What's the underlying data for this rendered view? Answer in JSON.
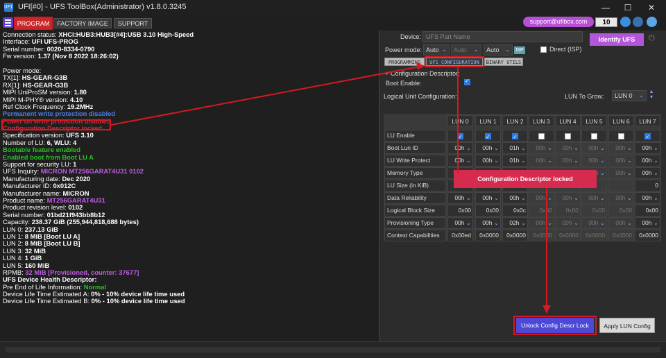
{
  "window": {
    "title": "UFI[#0] - UFS ToolBox(Administrator) v1.8.0.3245",
    "app_icon": "UFI",
    "minimize": "—",
    "maximize": "☐",
    "close": "✕"
  },
  "menu": {
    "tabs": [
      "PROGRAM",
      "FACTORY IMAGE",
      "SUPPORT"
    ],
    "support_email": "support@ufibox.com",
    "counter": "10"
  },
  "log": [
    {
      "text": "Connection status: ",
      "value": "XHCI:HUB3:HUB3[#4]:USB 3.10 High-Speed",
      "cls": ""
    },
    {
      "text": "Interface: ",
      "value": "UFI UFS-PROG",
      "cls": ""
    },
    {
      "text": " Serial number: ",
      "value": "0020-8334-0790",
      "cls": ""
    },
    {
      "text": " Fw version: ",
      "value": "1.37 (Nov  8 2022 18:26:02)",
      "cls": ""
    },
    {
      "text": "",
      "value": "",
      "cls": ""
    },
    {
      "text": "Power mode:",
      "value": "",
      "cls": ""
    },
    {
      "text": " TX[1]: ",
      "value": "HS-GEAR-G3B",
      "cls": ""
    },
    {
      "text": " RX[1]: ",
      "value": "HS-GEAR-G3B",
      "cls": ""
    },
    {
      "text": "MIPI UniProSM version: ",
      "value": "1.80",
      "cls": ""
    },
    {
      "text": "MIPI M-PHY® version: ",
      "value": "4.10",
      "cls": ""
    },
    {
      "text": "Ref Clock Frequency: ",
      "value": "19.2MHz",
      "cls": ""
    },
    {
      "text": "Permanent write protection disabled",
      "value": "",
      "cls": "c-blue"
    },
    {
      "text": "Power on write protection disabled",
      "value": "",
      "cls": "c-strike"
    },
    {
      "text": "Configuration Descriptor locked",
      "value": "",
      "cls": "c-red"
    },
    {
      "text": " Specification version: ",
      "value": "UFS 3.10",
      "cls": ""
    },
    {
      "text": " Number of LU: ",
      "value": "6, WLU: 4",
      "cls": ""
    },
    {
      "text": " Bootable feature enabled",
      "value": "",
      "cls": "c-green"
    },
    {
      "text": " Enabled boot from Boot LU A",
      "value": "",
      "cls": "c-green"
    },
    {
      "text": " Support for security LU: ",
      "value": "1",
      "cls": ""
    },
    {
      "text": " UFS Inquiry: ",
      "value": "MICRON   MT256GARAT4U31   0102",
      "cls": "purple-val"
    },
    {
      "text": " Manufacturing date: ",
      "value": "Dec 2020",
      "cls": ""
    },
    {
      "text": " Manufacturer ID: ",
      "value": "0x012C",
      "cls": ""
    },
    {
      "text": " Manufacturer name: ",
      "value": "MICRON",
      "cls": ""
    },
    {
      "text": " Product name: ",
      "value": "MT256GARAT4U31",
      "cls": "purple-val"
    },
    {
      "text": " Product revision level: ",
      "value": "0102",
      "cls": ""
    },
    {
      "text": " Serial number: ",
      "value": "01bd21f943bb8b12",
      "cls": ""
    },
    {
      "text": "Capacity: ",
      "value": "238.37 GiB (255,944,818,688 bytes)",
      "cls": ""
    },
    {
      "text": " LUN 0: ",
      "value": "237.13 GiB",
      "cls": ""
    },
    {
      "text": " LUN 1: ",
      "value": "8 MiB [Boot LU A]",
      "cls": ""
    },
    {
      "text": " LUN 2: ",
      "value": "8 MiB [Boot LU B]",
      "cls": ""
    },
    {
      "text": " LUN 3: ",
      "value": "32 MiB",
      "cls": ""
    },
    {
      "text": " LUN 4: ",
      "value": "1 GiB",
      "cls": ""
    },
    {
      "text": " LUN 5: ",
      "value": "160 MiB",
      "cls": ""
    },
    {
      "text": " RPMB: ",
      "value": "32 MiB [Provisioned, counter: 37677]",
      "cls": "purple-tail"
    },
    {
      "text": "UFS Device Health Descriptor:",
      "value": "",
      "cls": "bold"
    },
    {
      "text": " Pre End of Life Information: ",
      "value": "Normal",
      "cls": "green-val"
    },
    {
      "text": " Device Life Time Estimated A: ",
      "value": "0% - 10% device life time used",
      "cls": ""
    },
    {
      "text": " Device Life Time Estimated B: ",
      "value": "0% - 10% device life time used",
      "cls": ""
    }
  ],
  "device": {
    "label": "Device:",
    "placeholder": "UFS Part Name",
    "identify_button": "Identify UFS",
    "power_mode_label": "Power mode:",
    "power_mode_values": [
      "Auto",
      "Auto",
      "Auto"
    ],
    "isp": "ISP",
    "direct_label": "Direct (ISP)"
  },
  "subtabs": [
    "PROGRAMMING",
    "UFS CONFIGURATION",
    "BINARY UTILS"
  ],
  "config": {
    "descriptor_label": "Configuration Descriptor:",
    "boot_enable_label": "Boot Enable:",
    "logical_unit_label": "Logical Unit Configuration:",
    "lun_to_grow_label": "LUN To Grow:",
    "lun_to_grow_value": "LUN 0"
  },
  "table": {
    "columns": [
      "LUN 0",
      "LUN 1",
      "LUN 2",
      "LUN 3",
      "LUN 4",
      "LUN 5",
      "LUN 6",
      "LUN 7"
    ],
    "rows": [
      {
        "label": "LU Enable",
        "cells": [
          "✓",
          "✓",
          "✓",
          "☐",
          "☐",
          "☐",
          "☐",
          "✓"
        ]
      },
      {
        "label": "Boot Lun ID",
        "cells": [
          "00h",
          "00h",
          "01h",
          "00h",
          "00h",
          "00h",
          "00h",
          "00h"
        ]
      },
      {
        "label": "LU Write Protect",
        "cells": [
          "00h",
          "00h",
          "01h",
          "00h",
          "00h",
          "00h",
          "00h",
          "00h"
        ]
      },
      {
        "label": "Memory Type",
        "cells": [
          "00h",
          "00h",
          "00h",
          "00h",
          "00h",
          "00h",
          "00h",
          "00h"
        ]
      },
      {
        "label": "LU Size (in KiB)",
        "cells": [
          "2",
          "",
          "",
          "",
          "",
          "",
          "",
          "0"
        ]
      },
      {
        "label": "Data Reliability",
        "cells": [
          "00h",
          "00h",
          "00h",
          "00h",
          "00h",
          "00h",
          "00h",
          "00h"
        ]
      },
      {
        "label": "Logical Block Size",
        "cells": [
          "0x00",
          "0x00",
          "0x0c",
          "0x00",
          "0x00",
          "0x00",
          "0x00",
          "0x00"
        ]
      },
      {
        "label": "Provisioning Type",
        "cells": [
          "00h",
          "00h",
          "02h",
          "00h",
          "00h",
          "00h",
          "00h",
          "00h"
        ]
      },
      {
        "label": "Context Capabilities",
        "cells": [
          "0x00ed",
          "0x0000",
          "0x0000",
          "0x0000",
          "0x0000",
          "0x0000",
          "0x0000",
          "0x0000"
        ]
      }
    ]
  },
  "locked_badge": "Configuration Descriptor locked",
  "buttons": {
    "unlock": "Unlock Config Descr Lock",
    "apply": "Apply LUN Config"
  },
  "colors": {
    "accent_red": "#d71920",
    "program_tab": "#c9282a",
    "identify": "#b257d9",
    "unlock": "#4e48d6",
    "badge": "#d72a4f"
  }
}
